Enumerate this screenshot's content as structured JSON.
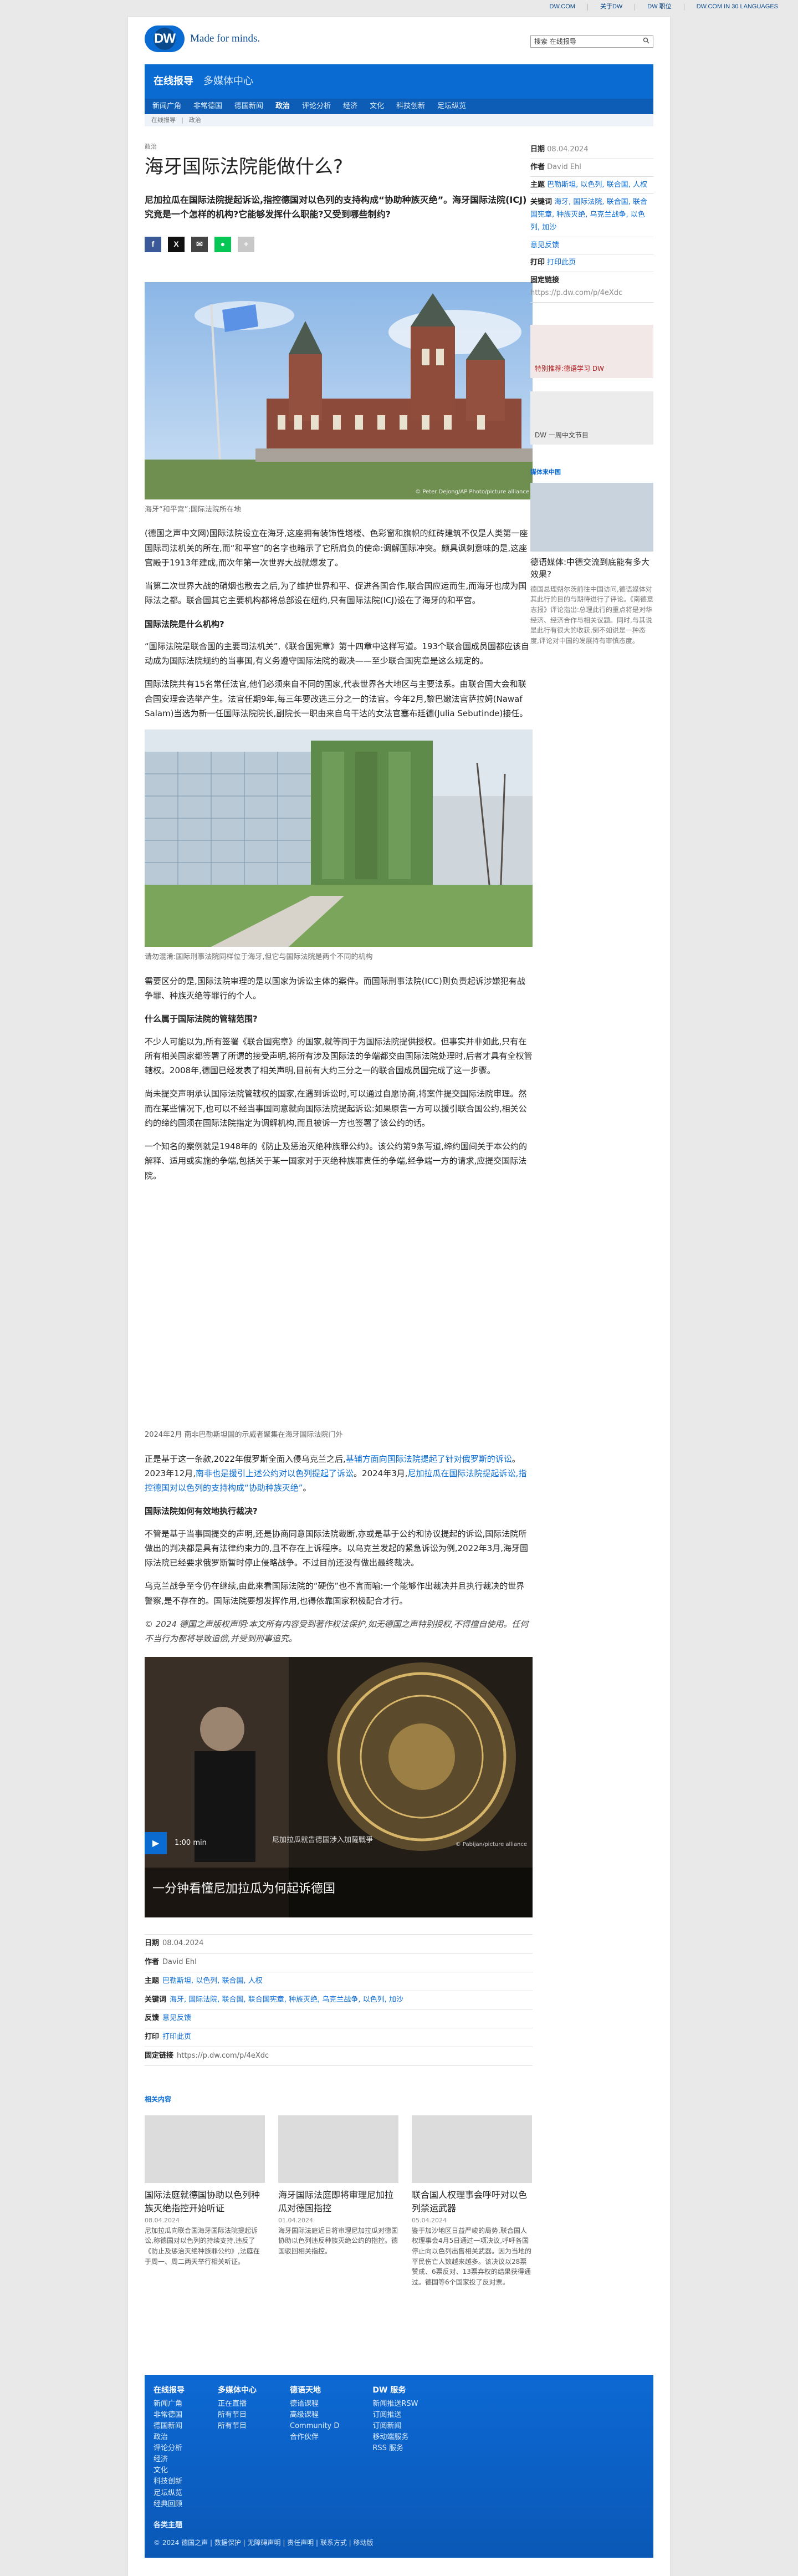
{
  "topbar": {
    "links": [
      "DW.COM",
      "关于DW",
      "DW 职位",
      "DW.COM IN 30 LANGUAGES"
    ]
  },
  "header": {
    "logo_text": "DW",
    "tagline": "Made for minds.",
    "search_placeholder": "搜索 在线报导",
    "search_icon": "search-icon"
  },
  "nav": {
    "title": "在线报导",
    "subtitle": "多媒体中心",
    "links": [
      "新闻广角",
      "非常德国",
      "德国新闻",
      "政治",
      "评论分析",
      "经济",
      "文化",
      "科技创新",
      "足坛纵览"
    ],
    "active": "政治",
    "crumbs": [
      "在线报导",
      "政治"
    ]
  },
  "article": {
    "kicker": "政治",
    "title": "海牙国际法院能做什么?",
    "lead": "尼加拉瓜在国际法院提起诉讼,指控德国对以色列的支持构成“协助种族灭绝”。海牙国际法院(ICJ)究竟是一个怎样的机构?它能够发挥什么职能?又受到哪些制约?",
    "share_icons": [
      "facebook-icon",
      "x-icon",
      "mail-icon",
      "line-icon",
      "more-icon"
    ],
    "image1_credit": "© Peter Dejong/AP Photo/picture alliance",
    "caption1": "海牙“和平宫”:国际法院所在地",
    "p1": "(德国之声中文网)国际法院设立在海牙,这座拥有装饰性塔楼、色彩窗和旗帜的红砖建筑不仅是人类第一座国际司法机关的所在,而“和平宫”的名字也暗示了它所肩负的使命:调解国际冲突。颇具讽刺意味的是,这座宫殿于1913年建成,而次年第一次世界大战就爆发了。",
    "p2": "当第二次世界大战的硝烟也散去之后,为了维护世界和平、促进各国合作,联合国应运而生,而海牙也成为国际法之都。联合国其它主要机构都将总部设在纽约,只有国际法院(ICJ)设在了海牙的和平宫。",
    "h_a": "国际法院是什么机构?",
    "p3": "“国际法院是联合国的主要司法机关”,《联合国宪章》第十四章中这样写道。193个联合国成员国都应该自动成为国际法院规约的当事国,有义务遵守国际法院的裁决——至少联合国宪章是这么规定的。",
    "p4": "国际法院共有15名常任法官,他们必须来自不同的国家,代表世界各大地区与主要法系。由联合国大会和联合国安理会选举产生。法官任期9年,每三年要改选三分之一的法官。今年2月,黎巴嫩法官萨拉姆(Nawaf Salam)当选为新一任国际法院院长,副院长一职由来自乌干达的女法官塞布廷德(Julia Sebutinde)接任。",
    "caption2": "请勿混淆:国际刑事法院同样位于海牙,但它与国际法院是两个不同的机构",
    "p5": "需要区分的是,国际法院审理的是以国家为诉讼主体的案件。而国际刑事法院(ICC)则负责起诉涉嫌犯有战争罪、种族灭绝等罪行的个人。",
    "h_b": "什么属于国际法院的管辖范围?",
    "p6": "不少人可能以为,所有签署《联合国宪章》的国家,就等同于为国际法院提供授权。但事实并非如此,只有在所有相关国家都签署了所谓的接受声明,将所有涉及国际法的争端都交由国际法院处理时,后者才具有全权管辖权。2008年,德国已经发表了相关声明,目前有大约三分之一的联合国成员国完成了这一步骤。",
    "p7": "尚未提交声明承认国际法院管辖权的国家,在遇到诉讼时,可以通过自愿协商,将案件提交国际法院审理。然而在某些情况下,也可以不经当事国同意就向国际法院提起诉讼:如果原告一方可以援引联合国公约,相关公约的缔约国须在国际法院指定为调解机构,而且被诉一方也签署了该公约的话。",
    "p8": "一个知名的案例就是1948年的《防止及惩治灭绝种族罪公约》。该公约第9条写道,缔约国间关于本公约的解释、适用或实施的争端,包括关于某一国家对于灭绝种族罪责任的争端,经争端一方的请求,应提交国际法院。",
    "video_caption_small": "2024年2月 南非巴勒斯坦国的示威者聚集在海牙国际法院门外",
    "p9_a": "正是基于这一条款,2022年俄罗斯全面入侵乌克兰之后,",
    "p9_link1": "基辅方面向国际法院提起了针对俄罗斯的诉讼",
    "p9_b": "。2023年12月,",
    "p9_link2": "南非也是援引上述公约对以色列提起了诉讼",
    "p9_c": "。2024年3月,",
    "p9_link3": "尼加拉瓜在国际法院提起诉讼,指控德国对以色列的支持构成“协助种族灭绝”",
    "p9_d": "。",
    "h_c": "国际法院如何有效地执行裁决?",
    "p10": "不管是基于当事国提交的声明,还是协商同意国际法院裁断,亦或是基于公约和协议提起的诉讼,国际法院所做出的判决都是具有法律约束力的,且不存在上诉程序。以乌克兰发起的紧急诉讼为例,2022年3月,海牙国际法院已经要求俄罗斯暂时停止侵略战争。不过目前还没有做出最终裁决。",
    "p11": "乌克兰战争至今仍在继续,由此来看国际法院的“硬伤”也不言而喻:一个能够作出裁决并且执行裁决的世界警察,是不存在的。国际法院要想发挥作用,也得依靠国家积极配合才行。",
    "copyright": "© 2024 德国之声版权声明:本文所有内容受到著作权法保护,如无德国之声特别授权,不得擅自使用。任何不当行为都将导致追偿,并受到刑事追究。",
    "video_duration": "1:00 min",
    "video_title": "一分钟看懂尼加拉瓜为何起诉德国",
    "video_overlay": "尼加拉瓜就告德国涉入加薩戰爭",
    "video_credit": "© Pabijan/picture alliance"
  },
  "meta": {
    "date_label": "日期",
    "date": "08.04.2024",
    "author_label": "作者",
    "author": "David Ehl",
    "topics_label": "主题",
    "topics": "巴勒斯坦, 以色列, 联合国, 人权",
    "keywords_label": "关键词",
    "keywords": "海牙, 国际法院, 联合国, 联合国宪章, 种族灭绝, 乌克兰战争, 以色列, 加沙",
    "feedback_label": "反馈",
    "feedback": "意见反馈",
    "print_label": "打印",
    "print": "打印此页",
    "permalink_label": "固定链接",
    "permalink": "https://p.dw.com/p/4eXdc"
  },
  "aside": {
    "date_label": "日期",
    "date": "08.04.2024",
    "author_label": "作者",
    "author": "David Ehl",
    "topics_label": "主题",
    "topics": "巴勒斯坦, 以色列, 联合国, 人权",
    "keywords_label": "关键词",
    "keywords": "海牙, 国际法院, 联合国, 联合国宪章, 种族灭绝, 乌克兰战争, 以色列, 加沙",
    "feedback": "意见反馈",
    "print_label": "打印",
    "print": "打印此页",
    "permalink_label": "固定链接",
    "permalink": "https://p.dw.com/p/4eXdc",
    "promo1": "特别推荐:德语学习 DW",
    "promo2": "DW 一周中文节目",
    "related_heading": "媒体来中国",
    "teaser_title": "德语媒体:中德交流到底能有多大效果?",
    "teaser_text": "德国总理朔尔茨前往中国访问,德语媒体对其此行的目的与期待进行了评论。《南德意志报》评论指出:总理此行的重点将是对华经济、经济合作与相关议题。同时,与其说是此行有很大的收获,倒不如说是一种态度,评论对中国的发展持有审慎态度。"
  },
  "related": {
    "heading": "相关内容",
    "items": [
      {
        "title": "国际法庭就德国协助以色列种族灭绝指控开始听证",
        "date": "08.04.2024",
        "text": "尼加拉瓜向联合国海牙国际法院提起诉讼,称德国对以色列的持续支持,违反了《防止及惩治灭绝种族罪公约》,法庭在于周一、周二两天举行相关听证。"
      },
      {
        "title": "海牙国际法庭即将审理尼加拉瓜对德国指控",
        "date": "01.04.2024",
        "text": "海牙国际法庭近日将审理尼加拉瓜对德国协助以色列违反种族灭绝公约的指控。德国驳回相关指控。"
      },
      {
        "title": "联合国人权理事会呼吁对以色列禁运武器",
        "date": "05.04.2024",
        "text": "鉴于加沙地区日益严峻的局势,联合国人权理事会4月5日通过一项决议,呼吁各国停止向以色列出售相关武器。因为当地的平民伤亡人数越来越多。该决议以28票赞成、6票反对、13票弃权的结果获得通过。德国等6个国家投了反对票。"
      }
    ]
  },
  "footer": {
    "col1_title": "在线报导",
    "col1": [
      "新闻广角",
      "非常德国",
      "德国新闻",
      "政治",
      "评论分析",
      "经济",
      "文化",
      "科技创新",
      "足坛纵览",
      "经典回顾"
    ],
    "col2_title": "多媒体中心",
    "col2": [
      "正在直播",
      "所有节目",
      "所有节目"
    ],
    "col3_title": "德语天地",
    "col3": [
      "德语课程",
      "高级课程",
      "Community D",
      "合作伙伴"
    ],
    "col4_title": "DW 服务",
    "col4": [
      "新闻推送RSW",
      "订阅推送",
      "订阅新闻",
      "移动端服务",
      "RSS 服务"
    ],
    "extra": "各类主题",
    "bottom": "© 2024 德国之声 | 数据保护 | 无障碍声明 | 责任声明 | 联系方式 | 移动版"
  }
}
